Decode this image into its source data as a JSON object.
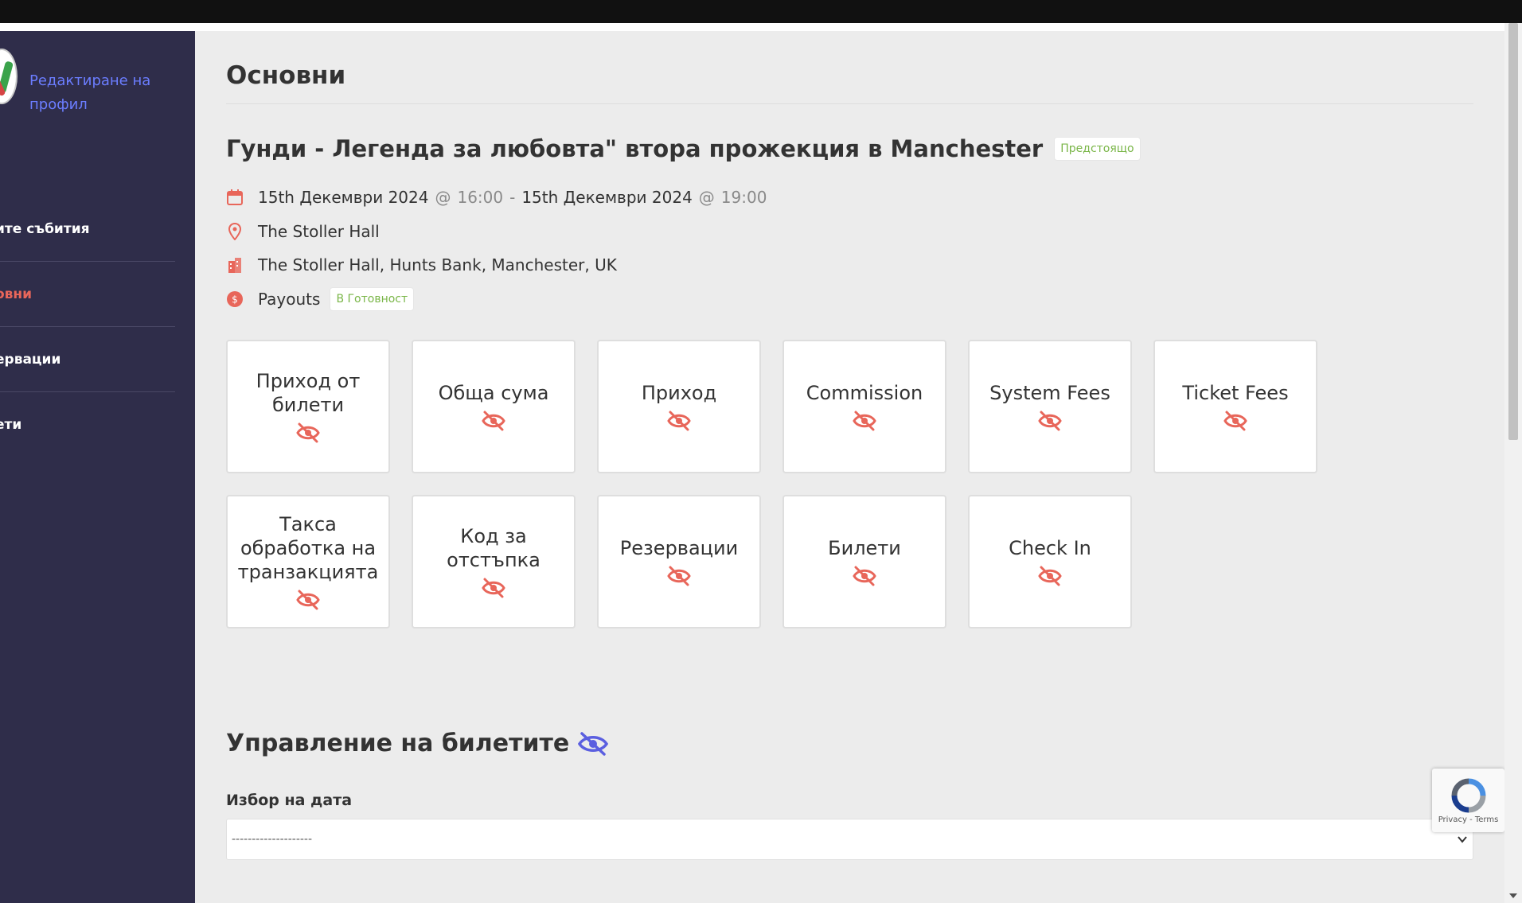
{
  "sidebar": {
    "profile_link": "Редактиране на профил",
    "items": [
      {
        "label": "ите събития"
      },
      {
        "label": "овни"
      },
      {
        "label": "ервации"
      },
      {
        "label": "ети"
      }
    ]
  },
  "main": {
    "page_title": "Основни",
    "event": {
      "title": "Гунди - Легенда за любовта\" втора прожекция в Manchester",
      "status": "Предстоящо",
      "start_date": "15th Декември 2024",
      "start_time": "16:00",
      "end_date": "15th Декември 2024",
      "end_time": "19:00",
      "at_symbol": "@",
      "dash": "-",
      "venue": "The Stoller Hall",
      "address": "The Stoller Hall, Hunts Bank, Manchester, UK",
      "payouts_label": "Payouts",
      "payouts_status": "В Готовност"
    },
    "stats": [
      {
        "label": "Приход от билети",
        "icon": "eye-slash-icon"
      },
      {
        "label": "Обща сума",
        "icon": "eye-slash-icon"
      },
      {
        "label": "Приход",
        "icon": "eye-slash-icon"
      },
      {
        "label": "Commission",
        "icon": "eye-slash-icon"
      },
      {
        "label": "System Fees",
        "icon": "eye-slash-icon"
      },
      {
        "label": "Ticket Fees",
        "icon": "eye-slash-icon"
      },
      {
        "label": "Такса обработка на транзакцията",
        "icon": "eye-slash-icon"
      },
      {
        "label": "Код за отстъпка",
        "icon": "eye-slash-icon"
      },
      {
        "label": "Резервации",
        "icon": "eye-slash-icon"
      },
      {
        "label": "Билети",
        "icon": "eye-slash-icon"
      },
      {
        "label": "Check In",
        "icon": "eye-slash-icon"
      }
    ],
    "ticket_management": {
      "title": "Управление на билетите",
      "date_label": "Избор на дата",
      "date_select_value": "--------------------"
    }
  },
  "recaptcha": {
    "terms": "Privacy - Terms"
  },
  "colors": {
    "sidebar_bg": "#2f2d4a",
    "accent": "#e8665a",
    "link": "#6b7dff",
    "badge_green": "#7ab648",
    "page_bg": "#ececec"
  }
}
